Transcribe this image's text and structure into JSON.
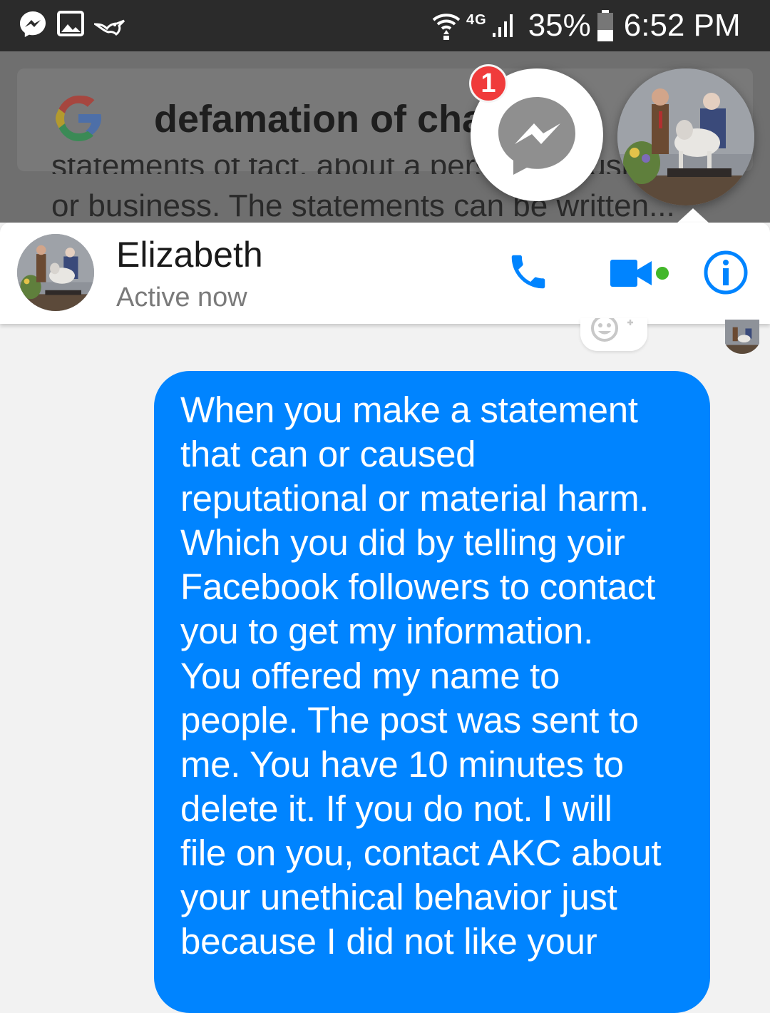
{
  "status_bar": {
    "network": "4G",
    "battery": "35%",
    "time": "6:52 PM"
  },
  "background": {
    "search_query": "defamation of char",
    "snippet_line": "or business. The statements can be written..."
  },
  "chat_heads": {
    "unread_badge": "1"
  },
  "chat_header": {
    "name": "Elizabeth",
    "status": "Active now",
    "accent_color": "#0084ff",
    "online_color": "#42b72a"
  },
  "message": {
    "text": "When you make a statement\nthat can or caused\nreputational or material harm.\nWhich you did by telling yoir\nFacebook followers to contact\nyou to get my information.\nYou offered my name to\npeople. The post was sent to\nme. You have 10 minutes to\ndelete it. If you do not. I will\nfile on you, contact AKC about\nyour unethical behavior just\nbecause I did not like your",
    "bubble_color": "#0084ff"
  }
}
